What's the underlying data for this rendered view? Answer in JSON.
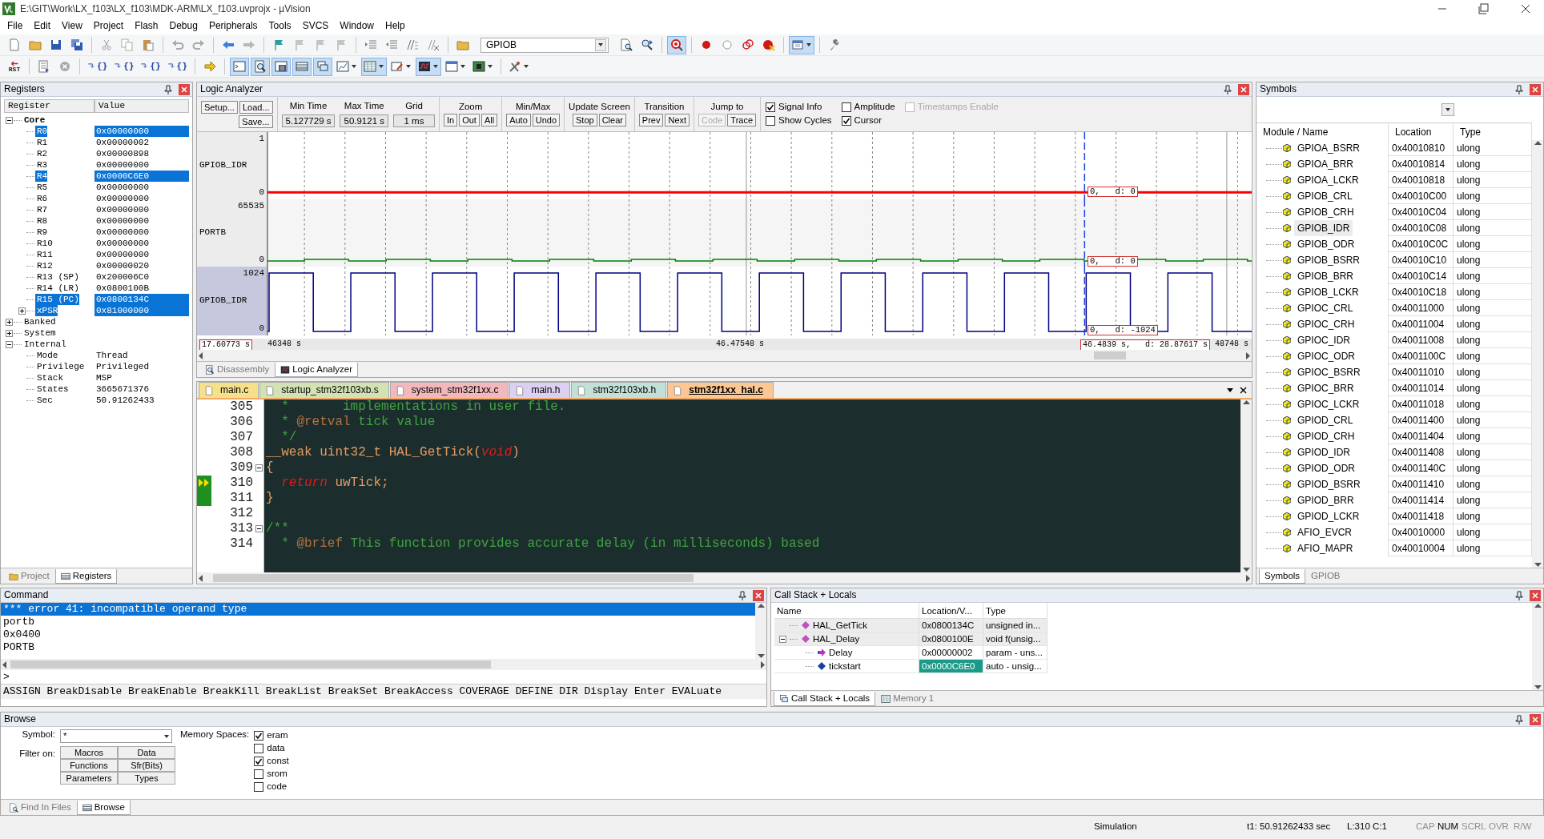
{
  "window": {
    "title": "E:\\GIT\\Work\\LX_f103\\LX_f103\\MDK-ARM\\LX_f103.uvprojx - µVision"
  },
  "menu": [
    "File",
    "Edit",
    "View",
    "Project",
    "Flash",
    "Debug",
    "Peripherals",
    "Tools",
    "SVCS",
    "Window",
    "Help"
  ],
  "toolbars": [
    [
      {
        "kind": "button",
        "pressed": false,
        "dropdown": false
      },
      {
        "kind": "button",
        "pressed": false,
        "dropdown": false
      },
      {
        "kind": "button",
        "pressed": false,
        "dropdown": false
      },
      {
        "kind": "button",
        "pressed": false,
        "dropdown": false
      },
      {
        "kind": "separator"
      },
      {
        "kind": "button",
        "pressed": false,
        "dropdown": false
      },
      {
        "kind": "button",
        "pressed": false,
        "dropdown": false
      },
      {
        "kind": "button",
        "pressed": false,
        "dropdown": false
      },
      {
        "kind": "separator"
      },
      {
        "kind": "button",
        "pressed": false,
        "dropdown": false
      },
      {
        "kind": "button",
        "pressed": false,
        "dropdown": false
      },
      {
        "kind": "separator"
      },
      {
        "kind": "button",
        "pressed": false,
        "dropdown": false
      },
      {
        "kind": "button",
        "pressed": false,
        "dropdown": false
      },
      {
        "kind": "separator"
      },
      {
        "kind": "button",
        "pressed": false,
        "dropdown": false
      },
      {
        "kind": "button",
        "pressed": false,
        "dropdown": false
      },
      {
        "kind": "button",
        "pressed": false,
        "dropdown": false
      },
      {
        "kind": "button",
        "pressed": false,
        "dropdown": false
      },
      {
        "kind": "separator"
      },
      {
        "kind": "button",
        "pressed": false,
        "dropdown": false
      },
      {
        "kind": "button",
        "pressed": false,
        "dropdown": false
      },
      {
        "kind": "button",
        "pressed": false,
        "dropdown": false
      },
      {
        "kind": "button",
        "pressed": false,
        "dropdown": false
      },
      {
        "kind": "separator"
      },
      {
        "kind": "button",
        "pressed": false,
        "dropdown": false
      },
      {
        "kind": "combo",
        "value": "GPIOB"
      },
      {
        "kind": "button",
        "pressed": false,
        "dropdown": false
      },
      {
        "kind": "button",
        "pressed": false,
        "dropdown": false
      },
      {
        "kind": "separator"
      },
      {
        "kind": "button",
        "pressed": true,
        "dropdown": false
      },
      {
        "kind": "separator"
      },
      {
        "kind": "button",
        "pressed": false,
        "dropdown": false
      },
      {
        "kind": "button",
        "pressed": false,
        "dropdown": false
      },
      {
        "kind": "button",
        "pressed": false,
        "dropdown": false
      },
      {
        "kind": "button",
        "pressed": false,
        "dropdown": false
      },
      {
        "kind": "separator"
      },
      {
        "kind": "button",
        "pressed": true,
        "dropdown": true
      },
      {
        "kind": "separator"
      },
      {
        "kind": "button",
        "pressed": false,
        "dropdown": false
      }
    ],
    [
      {
        "kind": "button",
        "label": "RST",
        "pressed": false,
        "dropdown": false
      },
      {
        "kind": "separator"
      },
      {
        "kind": "button",
        "pressed": false,
        "dropdown": false
      },
      {
        "kind": "button",
        "pressed": false,
        "dropdown": false
      },
      {
        "kind": "separator"
      },
      {
        "kind": "button",
        "label": "{}",
        "pressed": false,
        "dropdown": false
      },
      {
        "kind": "button",
        "label": "{}",
        "pressed": false,
        "dropdown": false
      },
      {
        "kind": "button",
        "label": "{}",
        "pressed": false,
        "dropdown": false
      },
      {
        "kind": "button",
        "label": "{}",
        "pressed": false,
        "dropdown": false
      },
      {
        "kind": "separator"
      },
      {
        "kind": "button",
        "pressed": false,
        "dropdown": false
      },
      {
        "kind": "separator"
      },
      {
        "kind": "button",
        "pressed": true,
        "dropdown": false
      },
      {
        "kind": "button",
        "pressed": true,
        "dropdown": false
      },
      {
        "kind": "button",
        "pressed": true,
        "dropdown": false
      },
      {
        "kind": "button",
        "pressed": true,
        "dropdown": false
      },
      {
        "kind": "button",
        "pressed": true,
        "dropdown": false
      },
      {
        "kind": "button",
        "pressed": false,
        "dropdown": true
      },
      {
        "kind": "button",
        "pressed": true,
        "dropdown": true
      },
      {
        "kind": "button",
        "pressed": false,
        "dropdown": true
      },
      {
        "kind": "button",
        "pressed": true,
        "dropdown": true
      },
      {
        "kind": "button",
        "pressed": false,
        "dropdown": true
      },
      {
        "kind": "button",
        "pressed": false,
        "dropdown": true
      },
      {
        "kind": "separator"
      },
      {
        "kind": "button",
        "pressed": false,
        "dropdown": true
      }
    ]
  ],
  "registers": {
    "title": "Registers",
    "columns": [
      "Register",
      "Value"
    ],
    "tree": [
      {
        "name": "Core",
        "kind": "node",
        "expanded": true,
        "bold": true,
        "selected": false,
        "children": [
          {
            "name": "R0",
            "value": "0x00000000",
            "kind": "leaf",
            "selected": true
          },
          {
            "name": "R1",
            "value": "0x00000002",
            "kind": "leaf",
            "selected": false
          },
          {
            "name": "R2",
            "value": "0x00000898",
            "kind": "leaf",
            "selected": false
          },
          {
            "name": "R3",
            "value": "0x00000000",
            "kind": "leaf",
            "selected": false
          },
          {
            "name": "R4",
            "value": "0x0000C6E0",
            "kind": "leaf",
            "selected": true
          },
          {
            "name": "R5",
            "value": "0x00000000",
            "kind": "leaf",
            "selected": false
          },
          {
            "name": "R6",
            "value": "0x00000000",
            "kind": "leaf",
            "selected": false
          },
          {
            "name": "R7",
            "value": "0x00000000",
            "kind": "leaf",
            "selected": false
          },
          {
            "name": "R8",
            "value": "0x00000000",
            "kind": "leaf",
            "selected": false
          },
          {
            "name": "R9",
            "value": "0x00000000",
            "kind": "leaf",
            "selected": false
          },
          {
            "name": "R10",
            "value": "0x00000000",
            "kind": "leaf",
            "selected": false
          },
          {
            "name": "R11",
            "value": "0x00000000",
            "kind": "leaf",
            "selected": false
          },
          {
            "name": "R12",
            "value": "0x00000020",
            "kind": "leaf",
            "selected": false
          },
          {
            "name": "R13 (SP)",
            "value": "0x200006C0",
            "kind": "leaf",
            "selected": false
          },
          {
            "name": "R14 (LR)",
            "value": "0x0800100B",
            "kind": "leaf",
            "selected": false
          },
          {
            "name": "R15 (PC)",
            "value": "0x0800134C",
            "kind": "leaf",
            "selected": true
          },
          {
            "name": "xPSR",
            "value": "0x81000000",
            "kind": "node",
            "expanded": false,
            "selected": true
          }
        ]
      },
      {
        "name": "Banked",
        "kind": "node",
        "expanded": false,
        "bold": false,
        "selected": false
      },
      {
        "name": "System",
        "kind": "node",
        "expanded": false,
        "bold": false,
        "selected": false
      },
      {
        "name": "Internal",
        "kind": "node",
        "expanded": true,
        "bold": false,
        "selected": false,
        "children": [
          {
            "name": "Mode",
            "value": "Thread",
            "kind": "leaf",
            "selected": false
          },
          {
            "name": "Privilege",
            "value": "Privileged",
            "kind": "leaf",
            "selected": false
          },
          {
            "name": "Stack",
            "value": "MSP",
            "kind": "leaf",
            "selected": false
          },
          {
            "name": "States",
            "value": "3665671376",
            "kind": "leaf",
            "selected": false
          },
          {
            "name": "Sec",
            "value": "50.91262433",
            "kind": "leaf",
            "selected": false
          }
        ]
      }
    ],
    "tabs": [
      {
        "label": "Project",
        "selected": false
      },
      {
        "label": "Registers",
        "selected": true
      }
    ]
  },
  "logic_analyzer": {
    "title": "Logic Analyzer",
    "file_buttons": [
      "Setup...",
      "Load...",
      "Save..."
    ],
    "readouts": [
      {
        "label": "Min Time",
        "value": "5.127729 s"
      },
      {
        "label": "Max Time",
        "value": "50.9121 s"
      },
      {
        "label": "Grid",
        "value": "1 ms"
      }
    ],
    "button_groups": [
      {
        "label": "Zoom",
        "buttons": [
          {
            "label": "In",
            "disabled": false
          },
          {
            "label": "Out",
            "disabled": false
          },
          {
            "label": "All",
            "disabled": false
          }
        ]
      },
      {
        "label": "Min/Max",
        "buttons": [
          {
            "label": "Auto",
            "disabled": false
          },
          {
            "label": "Undo",
            "disabled": false
          }
        ]
      },
      {
        "label": "Update Screen",
        "buttons": [
          {
            "label": "Stop",
            "disabled": false
          },
          {
            "label": "Clear",
            "disabled": false
          }
        ]
      },
      {
        "label": "Transition",
        "buttons": [
          {
            "label": "Prev",
            "disabled": false
          },
          {
            "label": "Next",
            "disabled": false
          }
        ]
      },
      {
        "label": "Jump to",
        "buttons": [
          {
            "label": "Code",
            "disabled": true
          },
          {
            "label": "Trace",
            "disabled": false
          }
        ]
      }
    ],
    "options": [
      {
        "label": "Signal Info",
        "checked": true,
        "disabled": false
      },
      {
        "label": "Amplitude",
        "checked": false,
        "disabled": false
      },
      {
        "label": "Timestamps Enable",
        "checked": false,
        "disabled": true
      },
      {
        "label": "Show Cycles",
        "checked": false,
        "disabled": false
      },
      {
        "label": "Cursor",
        "checked": true,
        "disabled": false
      }
    ],
    "signals": [
      {
        "name": "GPIOB_IDR",
        "max": "1",
        "min": "0",
        "kind": "flat",
        "color": "#ff0000",
        "selected": false,
        "cursor_value": "0,   d: 0"
      },
      {
        "name": "PORTB",
        "max": "65535",
        "min": "0",
        "kind": "ripple",
        "color": "#008000",
        "selected": false,
        "cursor_value": "0,   d: 0"
      },
      {
        "name": "GPIOB_IDR",
        "max": "1024",
        "min": "0",
        "kind": "square",
        "color": "#000080",
        "selected": true,
        "cursor_value": "0,   d: -1024"
      }
    ],
    "time_axis": {
      "left_marker": "17.60773 s",
      "start": "46348 s",
      "middle": "46.47548 s",
      "end": "48748 s",
      "cursor": "46.4839 s,   d: 28.87617 s"
    },
    "view_tabs": [
      {
        "label": "Disassembly",
        "selected": false
      },
      {
        "label": "Logic Analyzer",
        "selected": true
      }
    ]
  },
  "editor": {
    "tabs": [
      {
        "label": "main.c",
        "color": "#f6e08a",
        "selected": false
      },
      {
        "label": "startup_stm32f103xb.s",
        "color": "#d3e2b4",
        "selected": false
      },
      {
        "label": "system_stm32f1xx.c",
        "color": "#f2b8bc",
        "selected": false
      },
      {
        "label": "main.h",
        "color": "#dcd0f2",
        "selected": false
      },
      {
        "label": "stm32f103xb.h",
        "color": "#c2e0d8",
        "selected": false
      },
      {
        "label": "stm32f1xx_hal.c",
        "color": "#fbc894",
        "selected": true
      }
    ],
    "lines": [
      {
        "number": "305",
        "segments": [
          {
            "kind": "comment",
            "text": "  *       implementations in user file."
          }
        ]
      },
      {
        "number": "306",
        "segments": [
          {
            "kind": "comment",
            "text": "  * "
          },
          {
            "kind": "tag",
            "text": "@retval"
          },
          {
            "kind": "comment",
            "text": " tick value"
          }
        ]
      },
      {
        "number": "307",
        "segments": [
          {
            "kind": "comment",
            "text": "  */"
          }
        ]
      },
      {
        "number": "308",
        "segments": [
          {
            "kind": "plain",
            "text": "__weak uint32_t HAL_GetTick("
          },
          {
            "kind": "keyword",
            "text": "void"
          },
          {
            "kind": "plain",
            "text": ")"
          }
        ]
      },
      {
        "number": "309",
        "fold": true,
        "segments": [
          {
            "kind": "plain",
            "text": "{"
          }
        ]
      },
      {
        "number": "310",
        "current": true,
        "segments": [
          {
            "kind": "keyword",
            "text": "  return"
          },
          {
            "kind": "plain",
            "text": " uwTick;"
          }
        ]
      },
      {
        "number": "311",
        "segments": [
          {
            "kind": "plain",
            "text": "}"
          }
        ]
      },
      {
        "number": "312"
      },
      {
        "number": "313",
        "fold": true,
        "segments": [
          {
            "kind": "comment",
            "text": "/**"
          }
        ]
      },
      {
        "number": "314",
        "segments": [
          {
            "kind": "comment",
            "text": "  * "
          },
          {
            "kind": "tag",
            "text": "@brief"
          },
          {
            "kind": "comment",
            "text": " This function provides accurate delay (in milliseconds) based"
          }
        ]
      }
    ]
  },
  "symbols": {
    "title": "Symbols",
    "columns": [
      "Module / Name",
      "Location",
      "Type"
    ],
    "rows": [
      {
        "name": "GPIOA_BSRR",
        "location": "0x40010810",
        "type": "ulong",
        "selected": false
      },
      {
        "name": "GPIOA_BRR",
        "location": "0x40010814",
        "type": "ulong",
        "selected": false
      },
      {
        "name": "GPIOA_LCKR",
        "location": "0x40010818",
        "type": "ulong",
        "selected": false
      },
      {
        "name": "GPIOB_CRL",
        "location": "0x40010C00",
        "type": "ulong",
        "selected": false
      },
      {
        "name": "GPIOB_CRH",
        "location": "0x40010C04",
        "type": "ulong",
        "selected": false
      },
      {
        "name": "GPIOB_IDR",
        "location": "0x40010C08",
        "type": "ulong",
        "selected": true
      },
      {
        "name": "GPIOB_ODR",
        "location": "0x40010C0C",
        "type": "ulong",
        "selected": false
      },
      {
        "name": "GPIOB_BSRR",
        "location": "0x40010C10",
        "type": "ulong",
        "selected": false
      },
      {
        "name": "GPIOB_BRR",
        "location": "0x40010C14",
        "type": "ulong",
        "selected": false
      },
      {
        "name": "GPIOB_LCKR",
        "location": "0x40010C18",
        "type": "ulong",
        "selected": false
      },
      {
        "name": "GPIOC_CRL",
        "location": "0x40011000",
        "type": "ulong",
        "selected": false
      },
      {
        "name": "GPIOC_CRH",
        "location": "0x40011004",
        "type": "ulong",
        "selected": false
      },
      {
        "name": "GPIOC_IDR",
        "location": "0x40011008",
        "type": "ulong",
        "selected": false
      },
      {
        "name": "GPIOC_ODR",
        "location": "0x4001100C",
        "type": "ulong",
        "selected": false
      },
      {
        "name": "GPIOC_BSRR",
        "location": "0x40011010",
        "type": "ulong",
        "selected": false
      },
      {
        "name": "GPIOC_BRR",
        "location": "0x40011014",
        "type": "ulong",
        "selected": false
      },
      {
        "name": "GPIOC_LCKR",
        "location": "0x40011018",
        "type": "ulong",
        "selected": false
      },
      {
        "name": "GPIOD_CRL",
        "location": "0x40011400",
        "type": "ulong",
        "selected": false
      },
      {
        "name": "GPIOD_CRH",
        "location": "0x40011404",
        "type": "ulong",
        "selected": false
      },
      {
        "name": "GPIOD_IDR",
        "location": "0x40011408",
        "type": "ulong",
        "selected": false
      },
      {
        "name": "GPIOD_ODR",
        "location": "0x4001140C",
        "type": "ulong",
        "selected": false
      },
      {
        "name": "GPIOD_BSRR",
        "location": "0x40011410",
        "type": "ulong",
        "selected": false
      },
      {
        "name": "GPIOD_BRR",
        "location": "0x40011414",
        "type": "ulong",
        "selected": false
      },
      {
        "name": "GPIOD_LCKR",
        "location": "0x40011418",
        "type": "ulong",
        "selected": false
      },
      {
        "name": "AFIO_EVCR",
        "location": "0x40010000",
        "type": "ulong",
        "selected": false
      },
      {
        "name": "AFIO_MAPR",
        "location": "0x40010004",
        "type": "ulong",
        "selected": false
      }
    ],
    "tabs": [
      {
        "label": "Symbols",
        "selected": true
      },
      {
        "label": "GPIOB",
        "selected": false
      }
    ]
  },
  "command": {
    "title": "Command",
    "output": [
      {
        "text": "*** error 41: incompatible operand type",
        "selected": true
      },
      {
        "text": "portb",
        "selected": false
      },
      {
        "text": "0x0400",
        "selected": false
      },
      {
        "text": "PORTB",
        "selected": false
      }
    ],
    "prompt": ">",
    "hint": "ASSIGN BreakDisable BreakEnable BreakKill BreakList BreakSet BreakAccess COVERAGE DEFINE DIR Display Enter EVALuate"
  },
  "call_stack": {
    "title": "Call Stack + Locals",
    "columns": [
      "Name",
      "Location/V...",
      "Type"
    ],
    "tree": [
      {
        "name": "HAL_GetTick",
        "kind": "function",
        "location": "0x0800134C",
        "type": "unsigned in...",
        "changed": false
      },
      {
        "name": "HAL_Delay",
        "kind": "function",
        "location": "0x0800100E",
        "type": "void f(unsig...",
        "changed": false,
        "expanded": true,
        "children": [
          {
            "name": "Delay",
            "kind": "parameter",
            "location": "0x00000002",
            "type": "param - uns...",
            "changed": false
          },
          {
            "name": "tickstart",
            "kind": "local",
            "location": "0x0000C6E0",
            "type": "auto - unsig...",
            "changed": true
          }
        ]
      }
    ],
    "tabs": [
      {
        "label": "Call Stack + Locals",
        "selected": true
      },
      {
        "label": "Memory 1",
        "selected": false
      }
    ]
  },
  "browse": {
    "title": "Browse",
    "symbol_label": "Symbol:",
    "symbol_value": "*",
    "filter_label": "Filter on:",
    "filters": [
      "Macros",
      "Data",
      "Functions",
      "Sfr(Bits)",
      "Parameters",
      "Types"
    ],
    "memory_label": "Memory Spaces:",
    "memory_spaces": [
      {
        "label": "eram",
        "checked": true
      },
      {
        "label": "data",
        "checked": false
      },
      {
        "label": "const",
        "checked": true
      },
      {
        "label": "srom",
        "checked": false
      },
      {
        "label": "code",
        "checked": false
      }
    ],
    "tabs": [
      {
        "label": "Find In Files",
        "selected": false
      },
      {
        "label": "Browse",
        "selected": true
      }
    ]
  },
  "status_bar": {
    "mode": "Simulation",
    "time": "t1: 50.91262433 sec",
    "position": "L:310 C:1",
    "keys": [
      {
        "label": "CAP",
        "on": false
      },
      {
        "label": "NUM",
        "on": true
      },
      {
        "label": "SCRL",
        "on": false
      },
      {
        "label": "OVR",
        "on": false
      },
      {
        "label": "R/W",
        "on": false
      }
    ]
  }
}
